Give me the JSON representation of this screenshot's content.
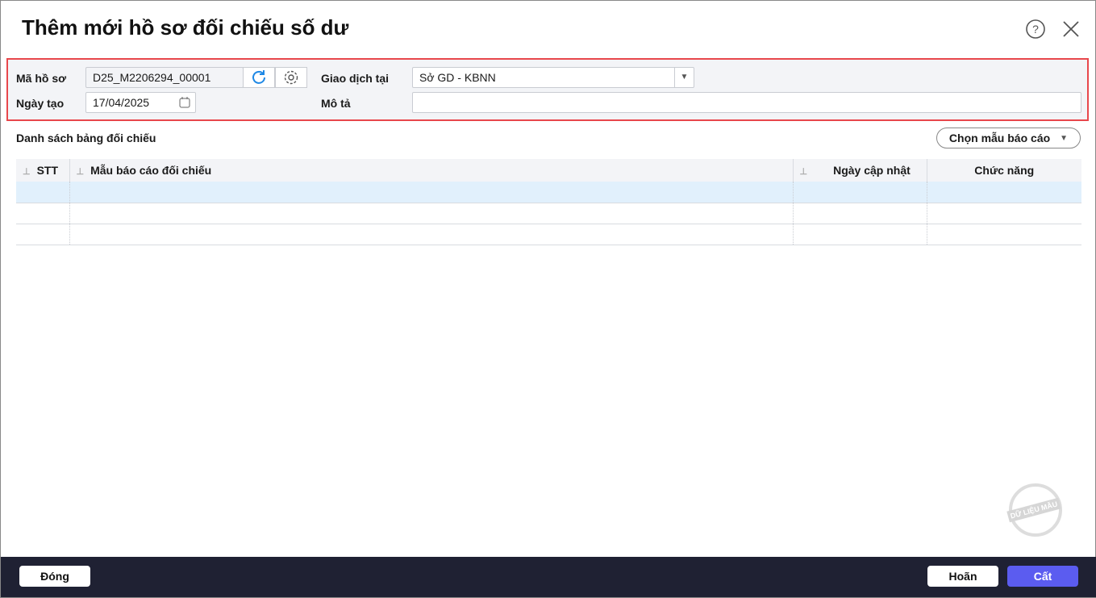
{
  "title": "Thêm mới hồ sơ đối chiếu số dư",
  "form": {
    "ma_ho_so_label": "Mã hồ sơ",
    "ma_ho_so_value": "D25_M2206294_00001",
    "ngay_tao_label": "Ngày tạo",
    "ngay_tao_value": "17/04/2025",
    "giao_dich_label": "Giao dịch tại",
    "giao_dich_value": "Sở GD - KBNN",
    "mo_ta_label": "Mô tả",
    "mo_ta_value": ""
  },
  "section_title": "Danh sách bảng đối chiếu",
  "choose_template": "Chọn mẫu báo cáo",
  "table": {
    "columns": [
      "STT",
      "Mẫu báo cáo đối chiếu",
      "Ngày cập nhật",
      "Chức năng"
    ]
  },
  "watermark": "DỮ LIỆU MẪU",
  "footer": {
    "close": "Đóng",
    "cancel": "Hoãn",
    "save": "Cất"
  },
  "colors": {
    "accent": "#5b5cf0",
    "highlight": "#e8474c"
  }
}
